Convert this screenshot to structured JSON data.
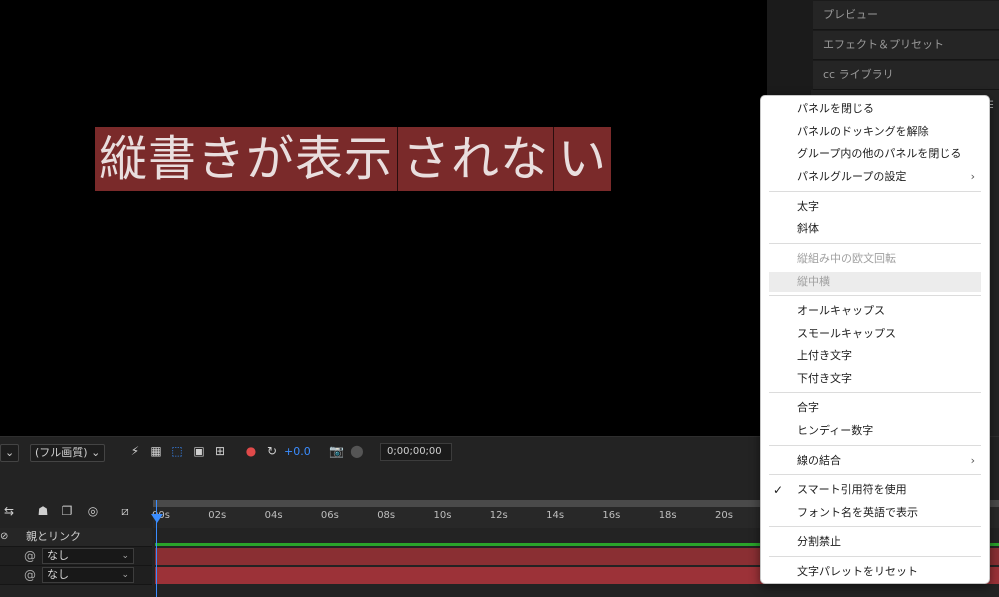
{
  "viewer": {
    "segments": [
      "縦書きが表示",
      "されな",
      "い"
    ]
  },
  "panels": {
    "tabs": [
      "プレビュー",
      "エフェクト＆プリセット",
      "cc ライブラリ"
    ]
  },
  "viewer_toolbar": {
    "zoom_caret": "⌄",
    "resolution": "(フル画質)",
    "exposure": "+0.0",
    "timecode": "0;00;00;00"
  },
  "timeline": {
    "ticks": [
      "00s",
      "02s",
      "04s",
      "06s",
      "08s",
      "10s",
      "12s",
      "14s",
      "16s",
      "18s",
      "20s"
    ],
    "parent_header": "親とリンク",
    "rows": [
      {
        "parent": "なし"
      },
      {
        "parent": "なし"
      }
    ]
  },
  "menu": {
    "items": [
      {
        "label": "パネルを閉じる"
      },
      {
        "label": "パネルのドッキングを解除"
      },
      {
        "label": "グループ内の他のパネルを閉じる"
      },
      {
        "label": "パネルグループの設定",
        "submenu": true
      },
      {
        "label": "太字"
      },
      {
        "label": "斜体"
      },
      {
        "label": "縦組み中の欧文回転",
        "disabled": true
      },
      {
        "label": "縦中横",
        "disabled": true,
        "highlight": true
      },
      {
        "label": "オールキャップス"
      },
      {
        "label": "スモールキャップス"
      },
      {
        "label": "上付き文字"
      },
      {
        "label": "下付き文字"
      },
      {
        "label": "合字"
      },
      {
        "label": "ヒンディー数字"
      },
      {
        "label": "線の結合",
        "submenu": true
      },
      {
        "label": "スマート引用符を使用",
        "checked": true
      },
      {
        "label": "フォント名を英語で表示"
      },
      {
        "label": "分割禁止"
      },
      {
        "label": "文字パレットをリセット"
      }
    ],
    "submenu_arrow": "›",
    "check_mark": "✓"
  },
  "colors": {
    "text_highlight": "#7a2a2a",
    "layer_track": "#8a2f33",
    "playhead": "#3b8dff",
    "accent_green": "#2aa32a"
  }
}
